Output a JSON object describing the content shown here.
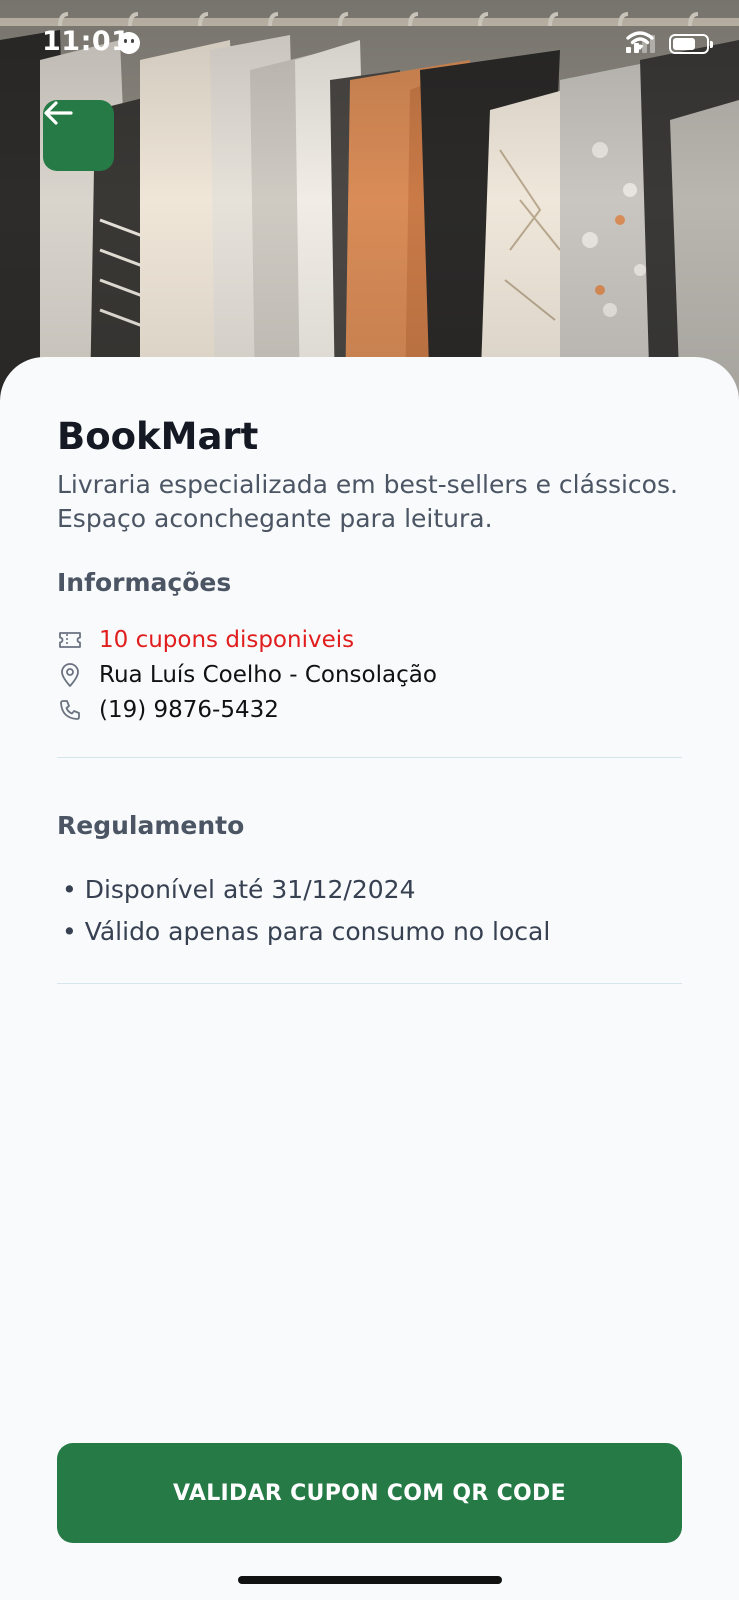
{
  "status_bar": {
    "time": "11:01"
  },
  "hero": {
    "image_subject": "clothes-rack-photo"
  },
  "nav": {
    "back_icon": "arrow-left-icon"
  },
  "store": {
    "name": "BookMart",
    "description": "Livraria especializada em best-sellers e clássicos. Espaço aconchegante para leitura."
  },
  "info_section": {
    "title": "Informações",
    "coupons": "10 cupons disponiveis",
    "address": "Rua Luís Coelho - Consolação",
    "phone": "(19) 9876-5432"
  },
  "rules_section": {
    "title": "Regulamento",
    "items": [
      "• Disponível até 31/12/2024",
      "• Válido apenas para consumo no local"
    ]
  },
  "actions": {
    "validate_label": "VALIDAR CUPON COM QR CODE"
  },
  "colors": {
    "primary_green": "#257a45",
    "coupon_red": "#e11d1d",
    "background": "#f8fafc"
  }
}
